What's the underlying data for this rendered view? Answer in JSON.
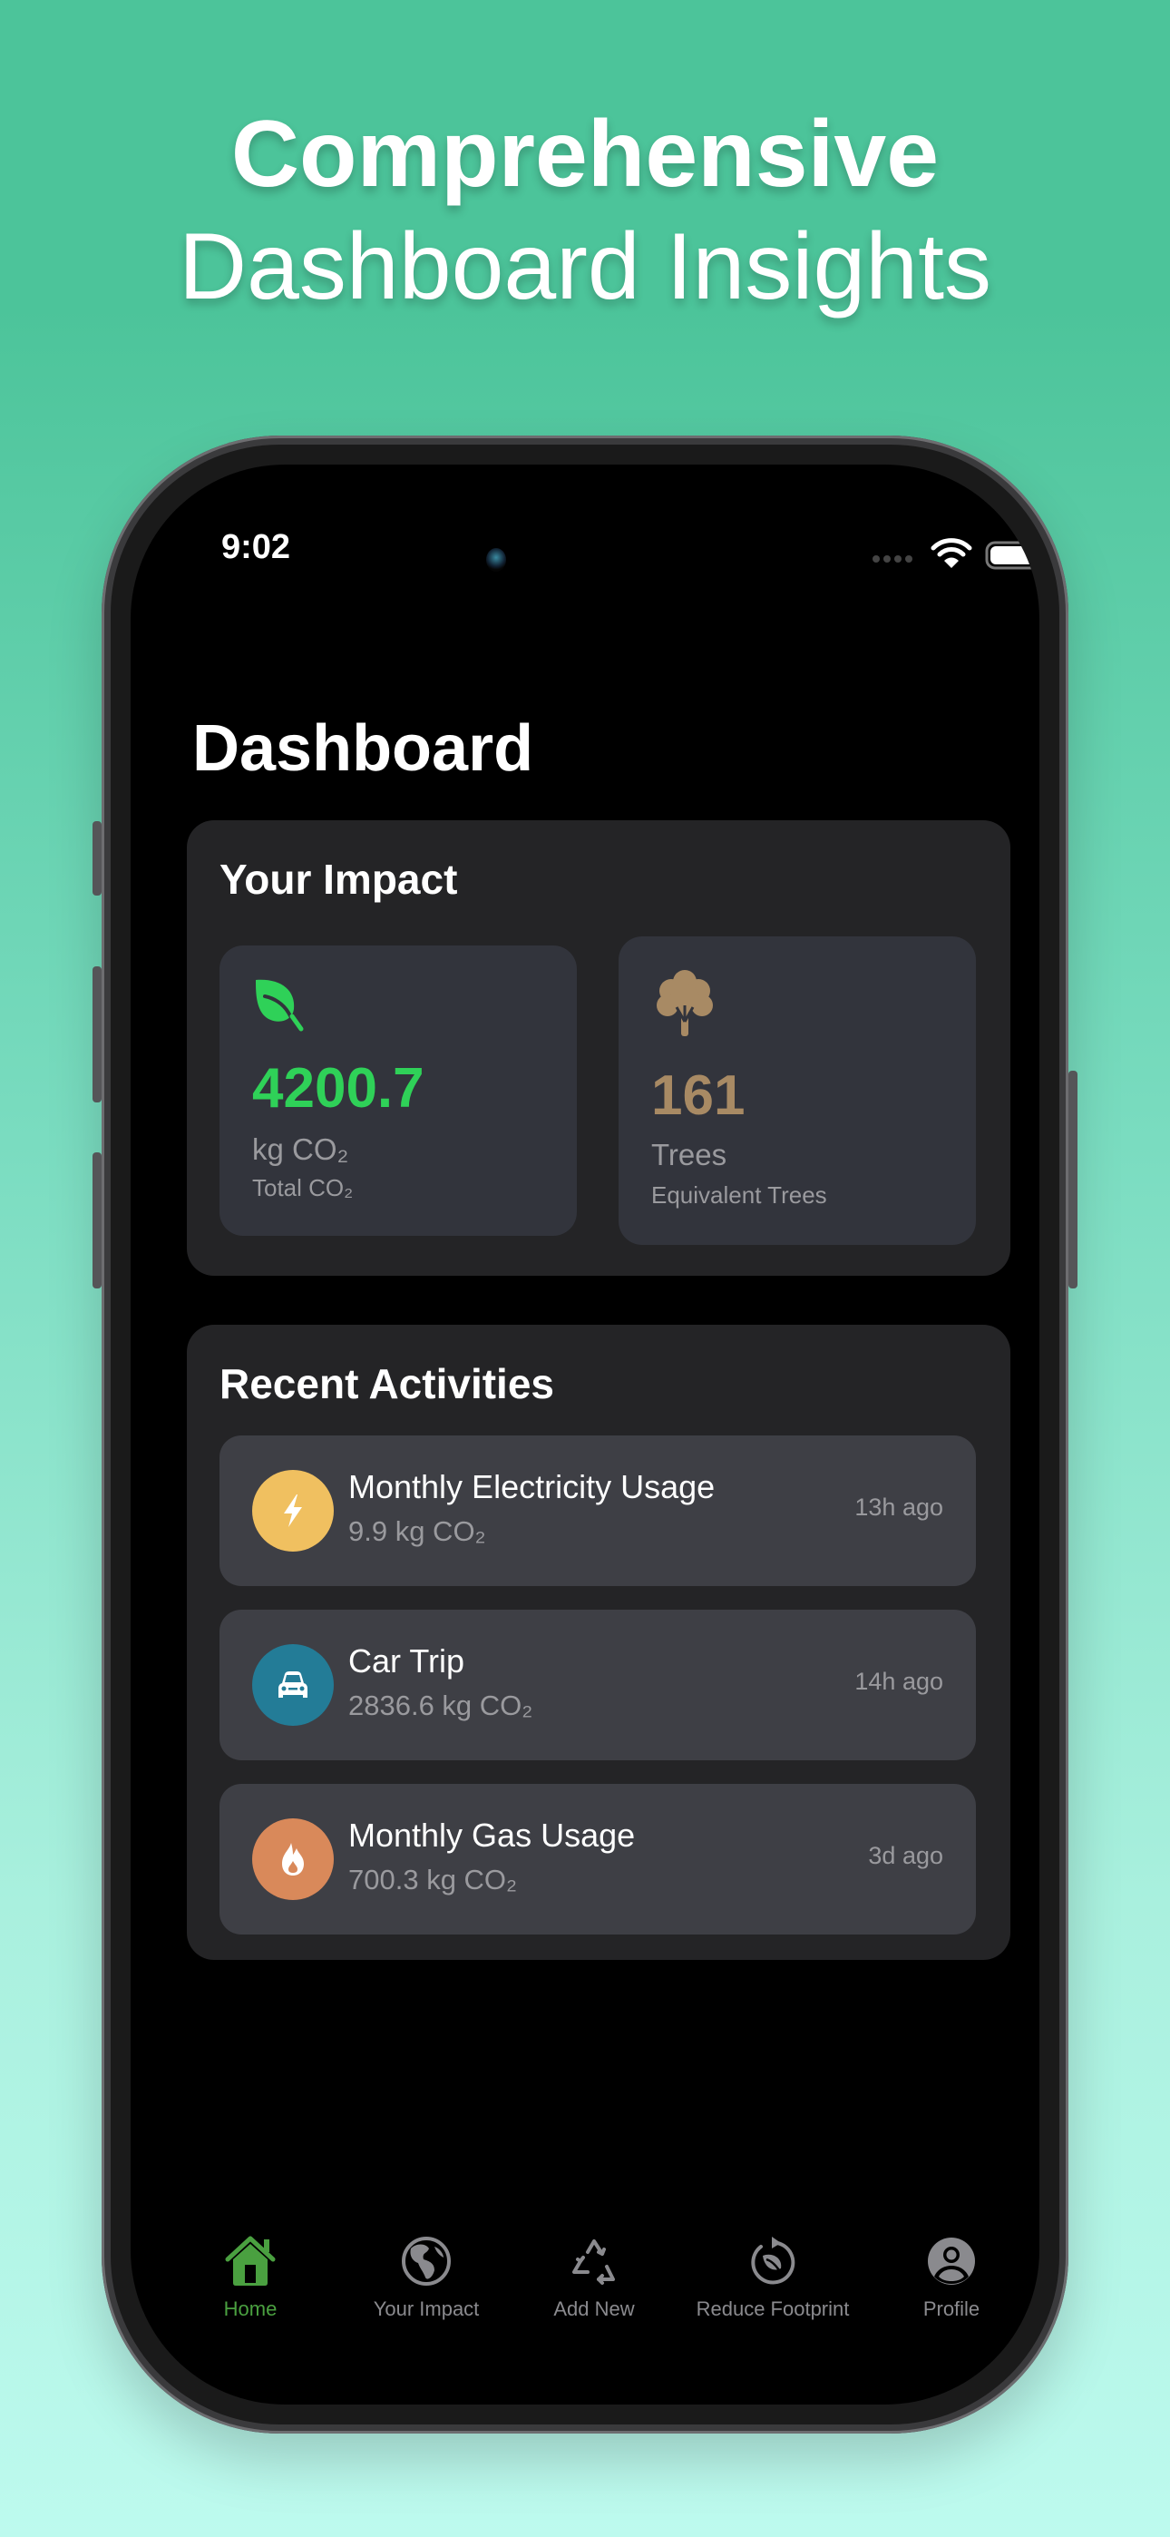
{
  "headline": {
    "line1": "Comprehensive",
    "line2": "Dashboard Insights"
  },
  "status_bar": {
    "time": "9:02",
    "icons": [
      "signal-dots-icon",
      "wifi-icon",
      "battery-icon"
    ]
  },
  "page": {
    "title": "Dashboard"
  },
  "impact": {
    "title": "Your Impact",
    "cards": [
      {
        "icon": "leaf-icon",
        "value": "4200.7",
        "unit": "kg CO₂",
        "label": "Total CO₂",
        "color": "#2fd158"
      },
      {
        "icon": "tree-icon",
        "value": "161",
        "unit": "Trees",
        "label": "Equivalent Trees",
        "color": "#a88a64"
      }
    ]
  },
  "activities": {
    "title": "Recent Activities",
    "items": [
      {
        "icon": "bolt-icon",
        "title": "Monthly Electricity Usage",
        "amount": "9.9 kg CO₂",
        "time": "13h ago",
        "color": "#f0c060"
      },
      {
        "icon": "car-icon",
        "title": "Car Trip",
        "amount": "2836.6 kg CO₂",
        "time": "14h ago",
        "color": "#237c97"
      },
      {
        "icon": "flame-icon",
        "title": "Monthly Gas Usage",
        "amount": "700.3 kg CO₂",
        "time": "3d ago",
        "color": "#d9895a"
      }
    ]
  },
  "tabbar": {
    "active_color": "#4aa040",
    "inactive_color": "#8a8a8e",
    "tabs": [
      {
        "icon": "house-icon",
        "label": "Home",
        "active": true
      },
      {
        "icon": "globe-icon",
        "label": "Your Impact",
        "active": false
      },
      {
        "icon": "recycle-icon",
        "label": "Add New",
        "active": false
      },
      {
        "icon": "refresh-leaf-icon",
        "label": "Reduce Footprint",
        "active": false
      },
      {
        "icon": "person-circle-icon",
        "label": "Profile",
        "active": false
      }
    ]
  }
}
